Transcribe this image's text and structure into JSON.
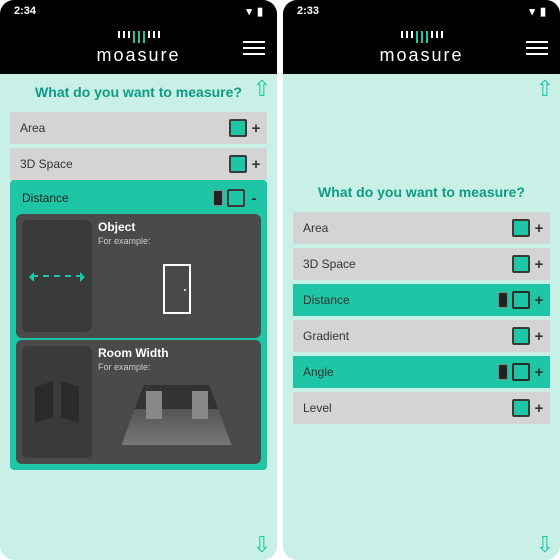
{
  "left": {
    "status_time": "2:34",
    "heading": "What do you want to measure?",
    "rows": [
      {
        "label": "Area",
        "phone": false,
        "sign": "+"
      },
      {
        "label": "3D Space",
        "phone": false,
        "sign": "+"
      }
    ],
    "expanded": {
      "label": "Distance",
      "sign": "-",
      "cards": [
        {
          "title": "Object",
          "sub": "For example:"
        },
        {
          "title": "Room Width",
          "sub": "For example:"
        }
      ]
    }
  },
  "right": {
    "status_time": "2:33",
    "heading": "What do you want to measure?",
    "rows": [
      {
        "label": "Area",
        "phone": false,
        "active": false,
        "sign": "+"
      },
      {
        "label": "3D Space",
        "phone": false,
        "active": false,
        "sign": "+"
      },
      {
        "label": "Distance",
        "phone": true,
        "active": true,
        "sign": "+"
      },
      {
        "label": "Gradient",
        "phone": false,
        "active": false,
        "sign": "+"
      },
      {
        "label": "Angle",
        "phone": true,
        "active": true,
        "sign": "+"
      },
      {
        "label": "Level",
        "phone": false,
        "active": false,
        "sign": "+"
      }
    ]
  },
  "brand": "moasure"
}
